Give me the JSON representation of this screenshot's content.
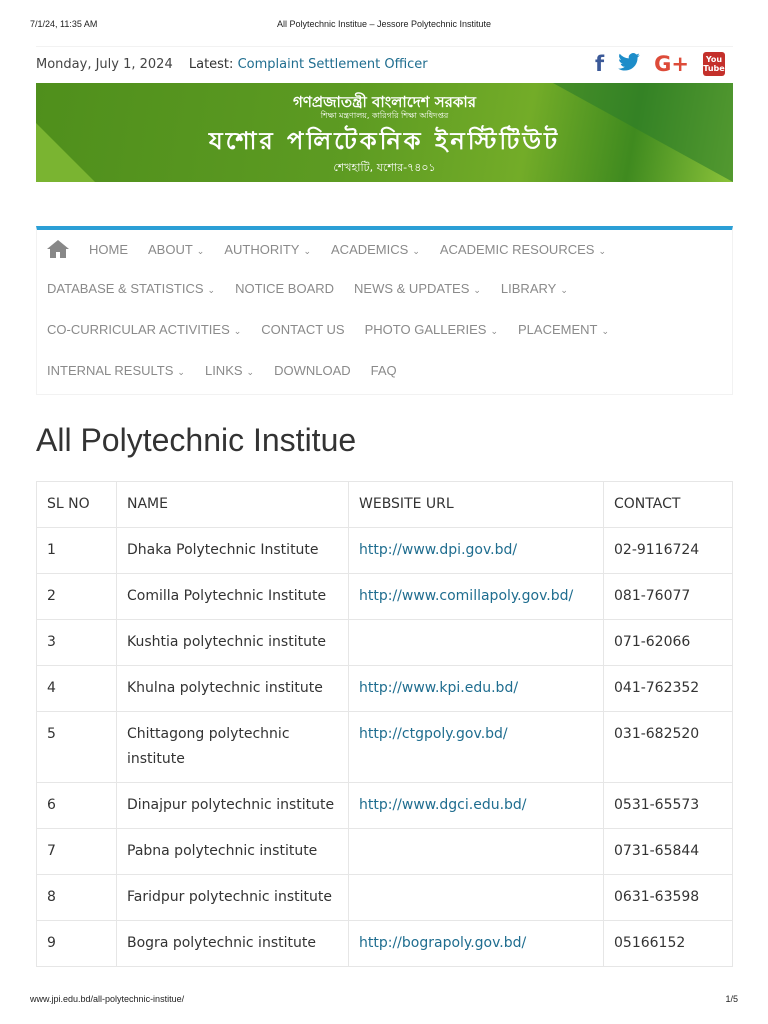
{
  "pdf": {
    "timestamp": "7/1/24, 11:35 AM",
    "page_title": "All Polytechnic Institue – Jessore Polytechnic Institute",
    "url": "www.jpi.edu.bd/all-polytechnic-institue/",
    "page": "1/5"
  },
  "topbar": {
    "date": "Monday, July 1, 2024",
    "latest_label": "Latest:",
    "latest_link": "Complaint Settlement Officer"
  },
  "social": {
    "facebook": "f",
    "twitter": "t",
    "googleplus": "G+",
    "youtube_top": "You",
    "youtube_bottom": "Tube"
  },
  "banner": {
    "line1": "গণপ্রজাতন্ত্রী বাংলাদেশ সরকার",
    "line2": "শিক্ষা মন্ত্রণালয়, কারিগরি শিক্ষা অধিদপ্তর",
    "line3": "যশোর পলিটেকনিক ইনস্টিটিউট",
    "line4": "শেখহাটি, যশোর-৭৪০১"
  },
  "nav": {
    "rows": [
      [
        {
          "label": "HOME",
          "dd": false
        },
        {
          "label": "ABOUT",
          "dd": true
        },
        {
          "label": "AUTHORITY",
          "dd": true
        },
        {
          "label": "ACADEMICS",
          "dd": true
        },
        {
          "label": "ACADEMIC RESOURCES",
          "dd": true
        }
      ],
      [
        {
          "label": "DATABASE & STATISTICS",
          "dd": true
        },
        {
          "label": "NOTICE BOARD",
          "dd": false
        },
        {
          "label": "NEWS & UPDATES",
          "dd": true
        },
        {
          "label": "LIBRARY",
          "dd": true
        }
      ],
      [
        {
          "label": "CO-CURRICULAR ACTIVITIES",
          "dd": true
        },
        {
          "label": "CONTACT US",
          "dd": false
        },
        {
          "label": "PHOTO GALLERIES",
          "dd": true
        },
        {
          "label": "PLACEMENT",
          "dd": true
        }
      ],
      [
        {
          "label": "INTERNAL RESULTS",
          "dd": true
        },
        {
          "label": "LINKS",
          "dd": true
        },
        {
          "label": "DOWNLOAD",
          "dd": false
        },
        {
          "label": "FAQ",
          "dd": false
        }
      ]
    ]
  },
  "main": {
    "title": "All Polytechnic Institue",
    "columns": [
      "SL NO",
      "NAME",
      "WEBSITE URL",
      "CONTACT"
    ],
    "rows": [
      [
        "1",
        "Dhaka Polytechnic Institute",
        "http://www.dpi.gov.bd/",
        "02-9116724"
      ],
      [
        "2",
        "Comilla Polytechnic Institute",
        "http://www.comillapoly.gov.bd/",
        "081-76077"
      ],
      [
        "3",
        "Kushtia polytechnic institute",
        "",
        "071-62066"
      ],
      [
        "4",
        "Khulna polytechnic institute",
        "http://www.kpi.edu.bd/",
        "041-762352"
      ],
      [
        "5",
        "Chittagong polytechnic institute",
        "http://ctgpoly.gov.bd/",
        "031-682520"
      ],
      [
        "6",
        "Dinajpur polytechnic institute",
        "http://www.dgci.edu.bd/",
        "0531-65573"
      ],
      [
        "7",
        "Pabna polytechnic institute",
        "",
        "0731-65844"
      ],
      [
        "8",
        "Faridpur polytechnic institute",
        "",
        "0631-63598"
      ],
      [
        "9",
        "Bogra polytechnic institute",
        "http://bograpoly.gov.bd/",
        "05166152"
      ]
    ]
  }
}
